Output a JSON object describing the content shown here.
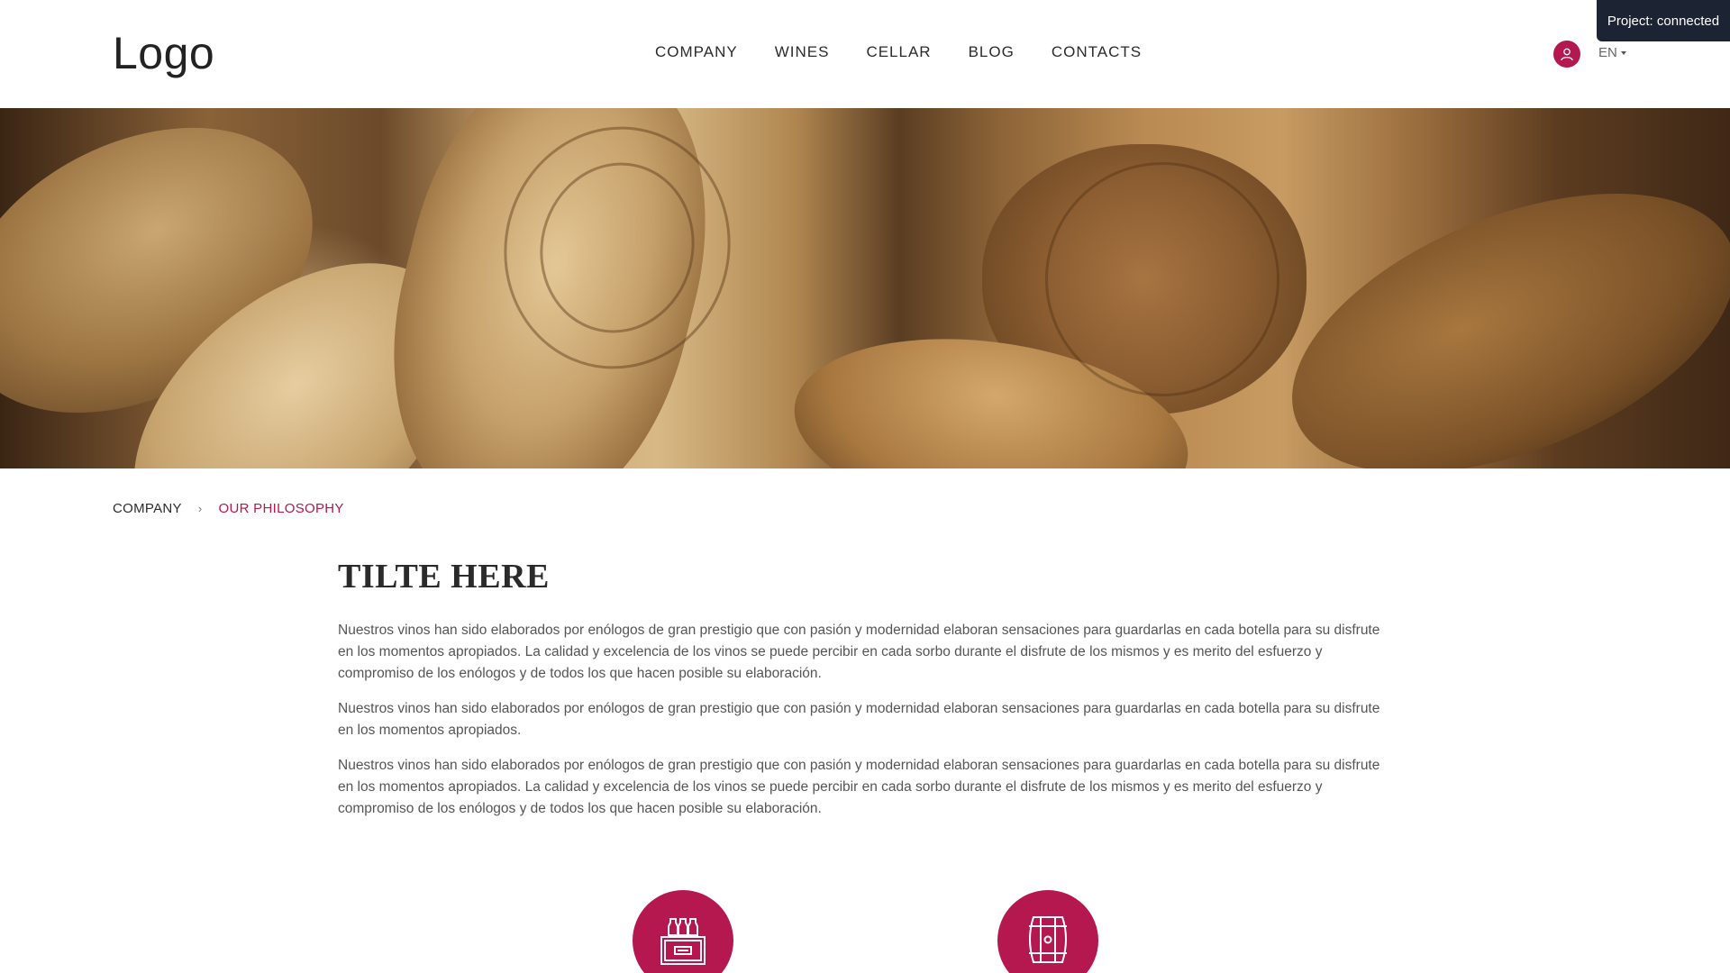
{
  "header": {
    "logo": "Logo",
    "nav": [
      "COMPANY",
      "WINES",
      "CELLAR",
      "BLOG",
      "CONTACTS"
    ],
    "language": "EN",
    "status": "Project: connected"
  },
  "breadcrumb": {
    "parent": "COMPANY",
    "current": "OUR PHILOSOPHY"
  },
  "content": {
    "title": "TILTE HERE",
    "paragraphs": [
      "Nuestros vinos han sido elaborados por enólogos de gran prestigio que con pasión y modernidad elaboran sensaciones para guardarlas en cada botella para su disfrute en los momentos apropiados. La calidad y excelencia de los vinos se puede percibir en cada sorbo durante el disfrute de los mismos y es merito del esfuerzo y compromiso de los enólogos y de todos los que hacen posible su elaboración.",
      "Nuestros vinos han sido elaborados por enólogos de gran prestigio que con pasión y modernidad elaboran sensaciones para guardarlas en cada botella para su disfrute en los momentos apropiados.",
      "Nuestros vinos han sido elaborados por enólogos de gran prestigio que con pasión y modernidad elaboran sensaciones para guardarlas en cada botella para su disfrute en los momentos apropiados. La calidad y excelencia de los vinos se puede percibir en cada sorbo durante el disfrute de los mismos y es merito del esfuerzo y compromiso de los enólogos y de todos los que hacen posible su elaboración."
    ]
  },
  "features": [
    {
      "icon": "wine-crate-icon"
    },
    {
      "icon": "wine-barrel-icon"
    }
  ],
  "colors": {
    "accent": "#b5174f",
    "status_bg": "#1c2333",
    "text": "#555555",
    "heading": "#2a2a2a"
  }
}
